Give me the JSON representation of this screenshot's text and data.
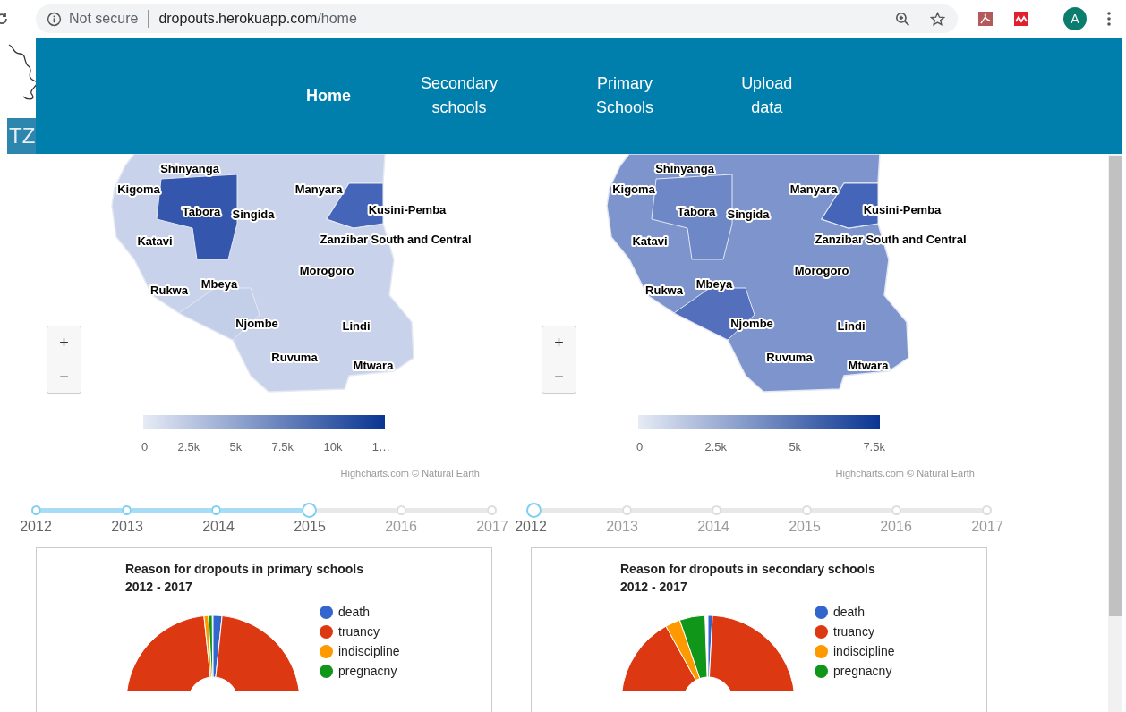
{
  "browser": {
    "security": "Not secure",
    "url_domain": "dropouts.herokuapp.com",
    "url_path": "/home",
    "avatar": "A"
  },
  "logo": "TZ",
  "nav": [
    {
      "label": "Home",
      "selected": true
    },
    {
      "label": "Secondary schools",
      "selected": false
    },
    {
      "label": "Primary Schools",
      "selected": false
    },
    {
      "label": "Upload data",
      "selected": false
    }
  ],
  "panels": [
    {
      "map": {
        "regions": [
          "Shinyanga",
          "Kigoma",
          "Manyara",
          "Tabora",
          "Singida",
          "Kusini-Pemba",
          "Katavi",
          "Zanzibar South and Central",
          "Morogoro",
          "Rukwa",
          "Mbeya",
          "Njombe",
          "Lindi",
          "Ruvuma",
          "Mtwara"
        ],
        "zoom_in": "+",
        "zoom_out": "−",
        "legend_labels": [
          "0",
          "2.5k",
          "5k",
          "7.5k",
          "10k",
          "1…"
        ],
        "credit": "Highcharts.com © Natural Earth"
      },
      "timeline": [
        {
          "label": "2012",
          "selected": false
        },
        {
          "label": "2013",
          "selected": false
        },
        {
          "label": "2014",
          "selected": false
        },
        {
          "label": "2015",
          "selected": true
        },
        {
          "label": "2016",
          "selected": false
        },
        {
          "label": "2017",
          "selected": false
        }
      ],
      "chart": {
        "title": "Reason for dropouts in primary schools",
        "subtitle": "2012 - 2017",
        "legend": [
          {
            "label": "death",
            "color": "#3366cc"
          },
          {
            "label": "truancy",
            "color": "#dc3912"
          },
          {
            "label": "indiscipline",
            "color": "#ff9900"
          },
          {
            "label": "pregnacny",
            "color": "#109618"
          }
        ]
      }
    },
    {
      "map": {
        "regions": [
          "Shinyanga",
          "Kigoma",
          "Manyara",
          "Tabora",
          "Singida",
          "Kusini-Pemba",
          "Katavi",
          "Zanzibar South and Central",
          "Morogoro",
          "Rukwa",
          "Mbeya",
          "Njombe",
          "Lindi",
          "Ruvuma",
          "Mtwara"
        ],
        "zoom_in": "+",
        "zoom_out": "−",
        "legend_labels": [
          "0",
          "2.5k",
          "5k",
          "7.5k"
        ],
        "credit": "Highcharts.com © Natural Earth"
      },
      "timeline": [
        {
          "label": "2012",
          "selected": true
        },
        {
          "label": "2013",
          "selected": false
        },
        {
          "label": "2014",
          "selected": false
        },
        {
          "label": "2015",
          "selected": false
        },
        {
          "label": "2016",
          "selected": false
        },
        {
          "label": "2017",
          "selected": false
        }
      ],
      "chart": {
        "title": "Reason for dropouts in secondary schools",
        "subtitle": "2012 - 2017",
        "legend": [
          {
            "label": "death",
            "color": "#3366cc"
          },
          {
            "label": "truancy",
            "color": "#dc3912"
          },
          {
            "label": "indiscipline",
            "color": "#ff9900"
          },
          {
            "label": "pregnacny",
            "color": "#109618"
          }
        ]
      }
    }
  ]
}
